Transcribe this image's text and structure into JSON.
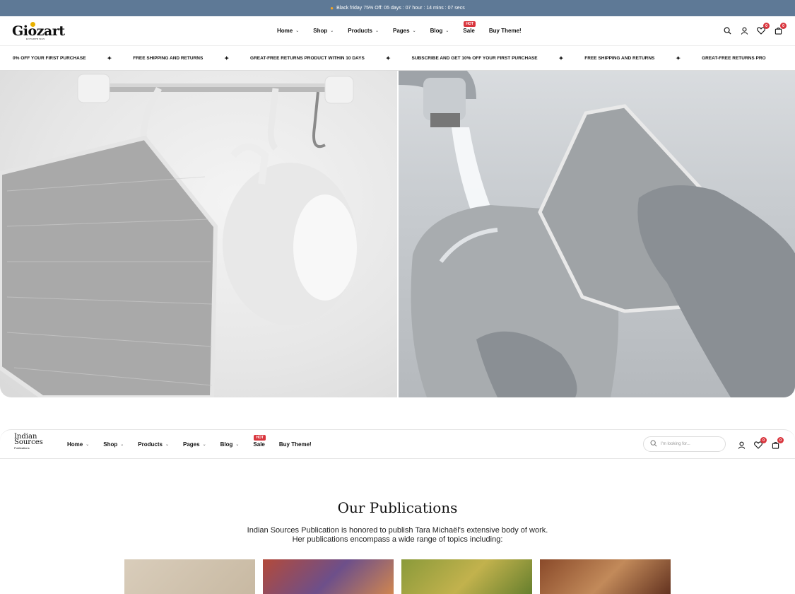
{
  "announcement": {
    "text": "Black friday 75% Off:  05 days : 07 hour : 14 mins : 07 secs"
  },
  "header": {
    "logo_text": "Giozart",
    "logo_sub": "ENTERPRISES",
    "nav": [
      {
        "label": "Home",
        "dropdown": true
      },
      {
        "label": "Shop",
        "dropdown": true
      },
      {
        "label": "Products",
        "dropdown": true
      },
      {
        "label": "Pages",
        "dropdown": true
      },
      {
        "label": "Blog",
        "dropdown": true
      },
      {
        "label": "Sale",
        "badge": "HOT"
      },
      {
        "label": "Buy Theme!"
      }
    ],
    "wishlist_count": "0",
    "cart_count": "0"
  },
  "marquee": {
    "items": [
      "0% OFF YOUR FIRST PURCHASE",
      "FREE SHIPPING AND RETURNS",
      "GREAT-FREE RETURNS PRODUCT WITHIN 10 DAYS",
      "SUBSCRIBE AND GET 10% OFF YOUR FIRST PURCHASE",
      "FREE SHIPPING AND RETURNS",
      "GREAT-FREE RETURNS PRO"
    ]
  },
  "header2": {
    "logo_line1": "Indian",
    "logo_line2": "Sources",
    "logo_line3": "Publications",
    "nav": [
      {
        "label": "Home"
      },
      {
        "label": "Shop"
      },
      {
        "label": "Products"
      },
      {
        "label": "Pages"
      },
      {
        "label": "Blog"
      },
      {
        "label": "Sale",
        "badge": "HOT"
      },
      {
        "label": "Buy Theme!"
      }
    ],
    "search_placeholder": "I'm looking for...",
    "wishlist_count": "0",
    "cart_count": "0"
  },
  "publications": {
    "title": "Our Publications",
    "desc_line1": "Indian Sources Publication is honored to publish Tara Michaël's extensive body of work.",
    "desc_line2": "Her publications encompass a wide range of topics including:"
  },
  "colors": {
    "announce_bg": "#5e7996",
    "badge": "#d9363e",
    "logo_dot": "#e8b100"
  }
}
